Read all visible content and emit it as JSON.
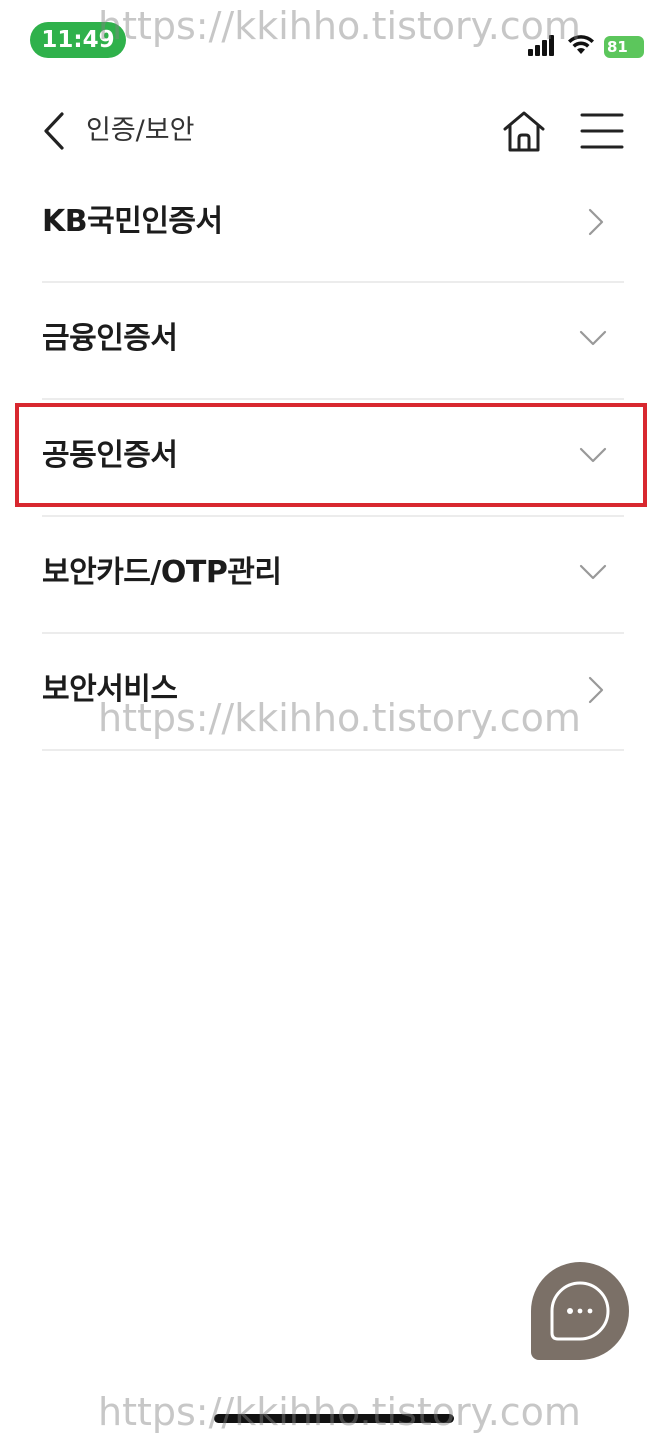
{
  "status_bar": {
    "time": "11:49",
    "battery": "81"
  },
  "header": {
    "title": "인증/보안"
  },
  "menu": {
    "items": [
      {
        "label": "KB국민인증서",
        "chevron": "chevron-right"
      },
      {
        "label": "금융인증서",
        "chevron": "chevron-down"
      },
      {
        "label": "공동인증서",
        "chevron": "chevron-down"
      },
      {
        "label": "보안카드/OTP관리",
        "chevron": "chevron-down"
      },
      {
        "label": "보안서비스",
        "chevron": "chevron-right"
      }
    ]
  },
  "highlight_color": "#d8282f",
  "watermark": "https://kkihho.tistory.com",
  "colors": {
    "time_pill": "#2fb14b",
    "chat_fab": "#7b7067",
    "battery": "#5cc65c"
  }
}
